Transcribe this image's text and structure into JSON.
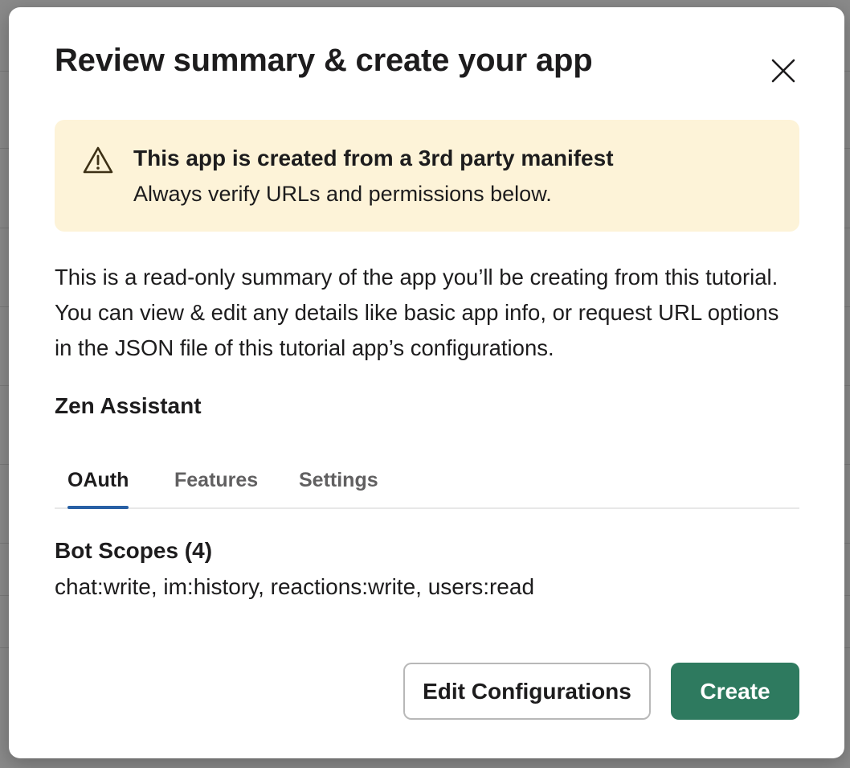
{
  "modal": {
    "title": "Review summary & create your app",
    "close_icon": "close-icon"
  },
  "warning": {
    "icon": "warning-icon",
    "title": "This app is created from a 3rd party manifest",
    "subtitle": "Always verify URLs and permissions below.",
    "background_color": "#fdf3d8"
  },
  "description": "This is a read-only summary of the app you’ll be creating from this tutorial. You can view & edit any details like basic app info, or request URL options in the JSON file of this tutorial app’s configurations.",
  "app": {
    "name": "Zen Assistant"
  },
  "tabs": [
    {
      "label": "OAuth",
      "active": true
    },
    {
      "label": "Features",
      "active": false
    },
    {
      "label": "Settings",
      "active": false
    }
  ],
  "oauth": {
    "scopes_title": "Bot Scopes (4)",
    "scopes_list": "chat:write, im:history, reactions:write, users:read"
  },
  "footer": {
    "edit_label": "Edit Configurations",
    "create_label": "Create"
  },
  "colors": {
    "tab_active_underline": "#2860a5",
    "primary_button": "#2e7a5f"
  }
}
